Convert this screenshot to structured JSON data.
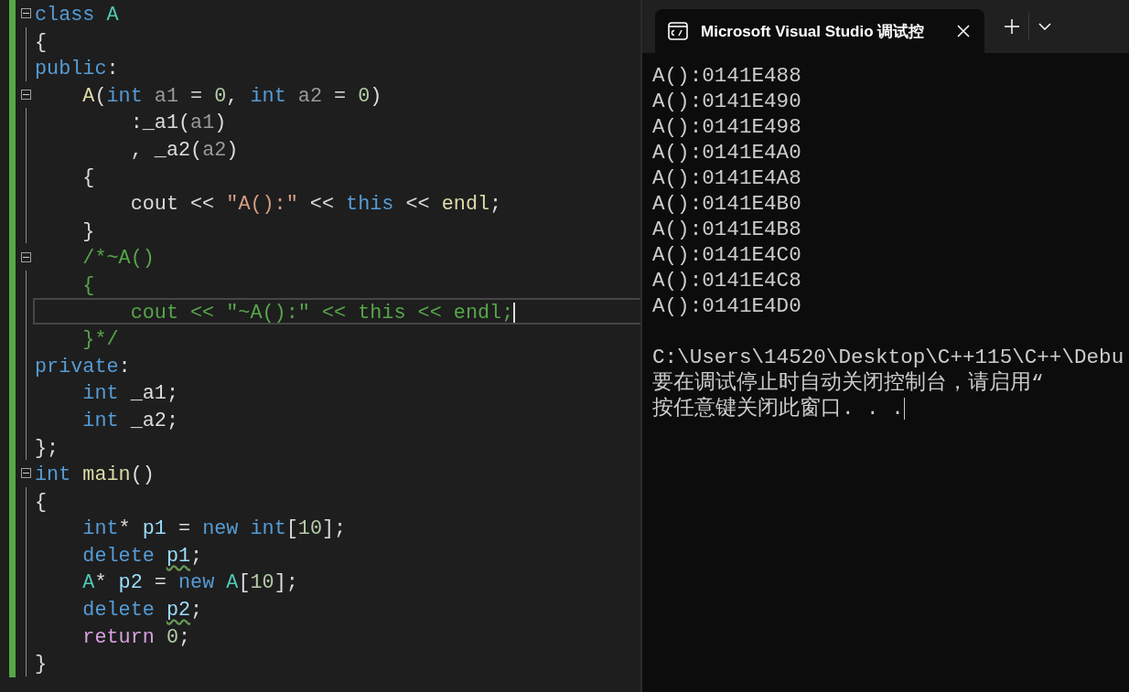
{
  "editor": {
    "lines": [
      {
        "fold": true,
        "current": false,
        "tokens": [
          {
            "text": "class",
            "kind": "keyword"
          },
          {
            "text": " A",
            "kind": "type"
          }
        ]
      },
      {
        "fold": false,
        "current": false,
        "tokens": [
          {
            "text": "{",
            "kind": "plain"
          }
        ]
      },
      {
        "fold": false,
        "current": false,
        "tokens": [
          {
            "text": "public",
            "kind": "keyword"
          },
          {
            "text": ":",
            "kind": "plain"
          }
        ]
      },
      {
        "fold": true,
        "current": false,
        "tokens": [
          {
            "text": "    A",
            "kind": "function"
          },
          {
            "text": "(",
            "kind": "plain"
          },
          {
            "text": "int",
            "kind": "keyword"
          },
          {
            "text": " a1",
            "kind": "param"
          },
          {
            "text": " = ",
            "kind": "plain"
          },
          {
            "text": "0",
            "kind": "number"
          },
          {
            "text": ", ",
            "kind": "plain"
          },
          {
            "text": "int",
            "kind": "keyword"
          },
          {
            "text": " a2",
            "kind": "param"
          },
          {
            "text": " = ",
            "kind": "plain"
          },
          {
            "text": "0",
            "kind": "number"
          },
          {
            "text": ")",
            "kind": "plain"
          }
        ]
      },
      {
        "fold": false,
        "current": false,
        "tokens": [
          {
            "text": "        :_a1(",
            "kind": "plain"
          },
          {
            "text": "a1",
            "kind": "param"
          },
          {
            "text": ")",
            "kind": "plain"
          }
        ]
      },
      {
        "fold": false,
        "current": false,
        "tokens": [
          {
            "text": "        , _a2(",
            "kind": "plain"
          },
          {
            "text": "a2",
            "kind": "param"
          },
          {
            "text": ")",
            "kind": "plain"
          }
        ]
      },
      {
        "fold": false,
        "current": false,
        "tokens": [
          {
            "text": "    {",
            "kind": "plain"
          }
        ]
      },
      {
        "fold": false,
        "current": false,
        "tokens": [
          {
            "text": "        cout << ",
            "kind": "plain"
          },
          {
            "text": "\"A():\"",
            "kind": "string"
          },
          {
            "text": " << ",
            "kind": "plain"
          },
          {
            "text": "this",
            "kind": "keyword"
          },
          {
            "text": " << ",
            "kind": "plain"
          },
          {
            "text": "endl",
            "kind": "function"
          },
          {
            "text": ";",
            "kind": "plain"
          }
        ]
      },
      {
        "fold": false,
        "current": false,
        "tokens": [
          {
            "text": "    }",
            "kind": "plain"
          }
        ]
      },
      {
        "fold": true,
        "current": false,
        "tokens": [
          {
            "text": "    /*~A()",
            "kind": "comment"
          }
        ]
      },
      {
        "fold": false,
        "current": false,
        "tokens": [
          {
            "text": "    {",
            "kind": "comment"
          }
        ]
      },
      {
        "fold": false,
        "current": true,
        "tokens": [
          {
            "text": "        cout << \"~A():\" << this << endl;",
            "kind": "comment"
          }
        ]
      },
      {
        "fold": false,
        "current": false,
        "tokens": [
          {
            "text": "    }*/",
            "kind": "comment"
          }
        ]
      },
      {
        "fold": false,
        "current": false,
        "tokens": [
          {
            "text": "private",
            "kind": "keyword"
          },
          {
            "text": ":",
            "kind": "plain"
          }
        ]
      },
      {
        "fold": false,
        "current": false,
        "tokens": [
          {
            "text": "    int",
            "kind": "keyword"
          },
          {
            "text": " _a1;",
            "kind": "plain"
          }
        ]
      },
      {
        "fold": false,
        "current": false,
        "tokens": [
          {
            "text": "    int",
            "kind": "keyword"
          },
          {
            "text": " _a2;",
            "kind": "plain"
          }
        ]
      },
      {
        "fold": false,
        "current": false,
        "tokens": [
          {
            "text": "};",
            "kind": "plain"
          }
        ]
      },
      {
        "fold": true,
        "current": false,
        "tokens": [
          {
            "text": "int",
            "kind": "keyword"
          },
          {
            "text": " main",
            "kind": "function"
          },
          {
            "text": "()",
            "kind": "plain"
          }
        ]
      },
      {
        "fold": false,
        "current": false,
        "tokens": [
          {
            "text": "{",
            "kind": "plain"
          }
        ]
      },
      {
        "fold": false,
        "current": false,
        "tokens": [
          {
            "text": "    int",
            "kind": "keyword"
          },
          {
            "text": "* ",
            "kind": "plain"
          },
          {
            "text": "p1",
            "kind": "variable"
          },
          {
            "text": " = ",
            "kind": "plain"
          },
          {
            "text": "new",
            "kind": "keyword"
          },
          {
            "text": " int",
            "kind": "keyword"
          },
          {
            "text": "[",
            "kind": "plain"
          },
          {
            "text": "10",
            "kind": "number"
          },
          {
            "text": "];",
            "kind": "plain"
          }
        ]
      },
      {
        "fold": false,
        "current": false,
        "tokens": [
          {
            "text": "    delete ",
            "kind": "keyword"
          },
          {
            "text": "p1",
            "kind": "squiggle"
          },
          {
            "text": ";",
            "kind": "plain"
          }
        ]
      },
      {
        "fold": false,
        "current": false,
        "tokens": [
          {
            "text": "    A",
            "kind": "type"
          },
          {
            "text": "* ",
            "kind": "plain"
          },
          {
            "text": "p2",
            "kind": "variable"
          },
          {
            "text": " = ",
            "kind": "plain"
          },
          {
            "text": "new",
            "kind": "keyword"
          },
          {
            "text": " A",
            "kind": "type"
          },
          {
            "text": "[",
            "kind": "plain"
          },
          {
            "text": "10",
            "kind": "number"
          },
          {
            "text": "];",
            "kind": "plain"
          }
        ]
      },
      {
        "fold": false,
        "current": false,
        "tokens": [
          {
            "text": "    delete ",
            "kind": "keyword"
          },
          {
            "text": "p2",
            "kind": "squiggle"
          },
          {
            "text": ";",
            "kind": "plain"
          }
        ]
      },
      {
        "fold": false,
        "current": false,
        "tokens": [
          {
            "text": "    return",
            "kind": "control"
          },
          {
            "text": " 0",
            "kind": "number"
          },
          {
            "text": ";",
            "kind": "plain"
          }
        ]
      },
      {
        "fold": false,
        "current": false,
        "tokens": [
          {
            "text": "}",
            "kind": "plain"
          }
        ]
      }
    ]
  },
  "terminal": {
    "tab": {
      "title": "Microsoft Visual Studio 调试控",
      "selected": true
    },
    "output": [
      "A():0141E488",
      "A():0141E490",
      "A():0141E498",
      "A():0141E4A0",
      "A():0141E4A8",
      "A():0141E4B0",
      "A():0141E4B8",
      "A():0141E4C0",
      "A():0141E4C8",
      "A():0141E4D0"
    ],
    "messages": [
      "C:\\Users\\14520\\Desktop\\C++115\\C++\\Debu",
      "要在调试停止时自动关闭控制台，请启用“",
      "按任意键关闭此窗口. . ."
    ]
  }
}
